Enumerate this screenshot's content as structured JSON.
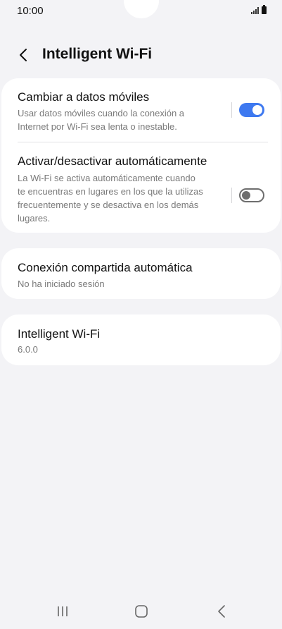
{
  "status": {
    "time": "10:00"
  },
  "header": {
    "title": "Intelligent Wi-Fi"
  },
  "settings": {
    "mobile_data": {
      "title": "Cambiar a datos móviles",
      "desc_line1": "Usar datos móviles cuando la conexión a",
      "desc_line2": "Internet por Wi-Fi sea lenta o inestable.",
      "enabled": true
    },
    "auto_toggle": {
      "title": "Activar/desactivar automáticamente",
      "desc_line1": "La Wi-Fi se activa automáticamente cuando",
      "desc_line2": "te encuentras en lugares en los que la utilizas",
      "desc_line3": "frecuentemente y se desactiva en los demás",
      "desc_line4": "lugares.",
      "enabled": false
    },
    "hotspot": {
      "title": "Conexión compartida automática",
      "subtitle": "No ha iniciado sesión"
    },
    "about": {
      "title": "Intelligent Wi-Fi",
      "version": "6.0.0"
    }
  },
  "colors": {
    "accent": "#3e79f0",
    "background": "#f3f3f6",
    "card": "#ffffff"
  },
  "icons": {
    "back": "chevron-left-icon",
    "recents": "recent-apps-icon",
    "home": "home-icon",
    "nav_back": "back-icon"
  }
}
